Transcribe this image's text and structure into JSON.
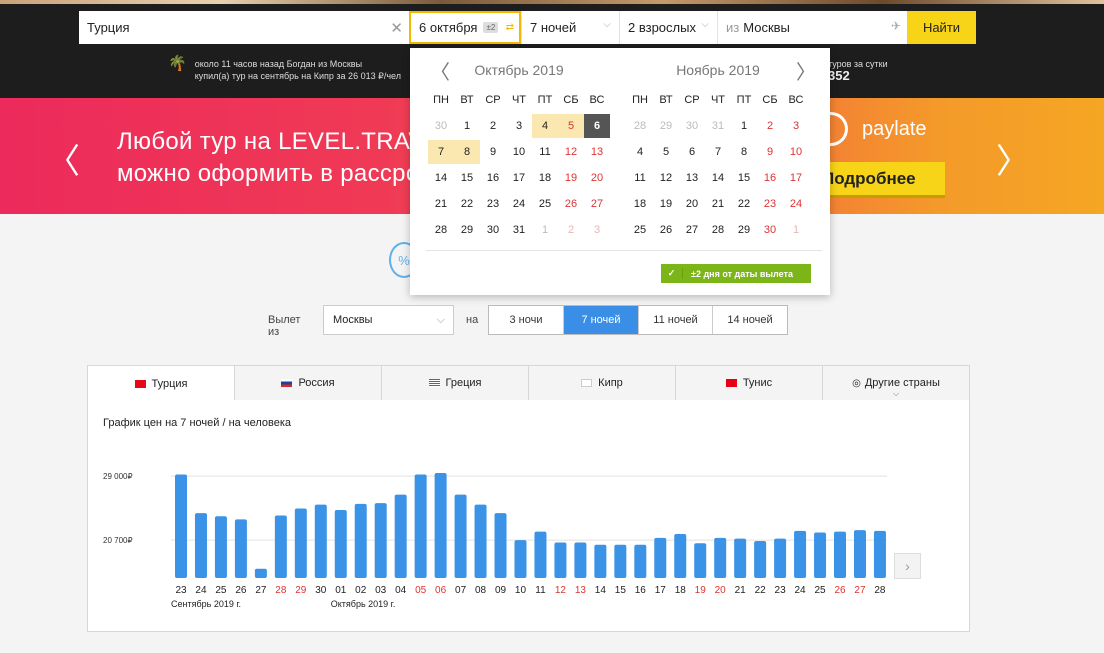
{
  "search": {
    "destination": "Турция",
    "date": "6 октября",
    "date_flex": "±2",
    "nights": "7 ночей",
    "people": "2 взрослых",
    "from_prefix": "из",
    "from_city": "Москвы",
    "find_label": "Найти"
  },
  "ticker": {
    "line1": "около 11 часов назад Богдан из Москвы",
    "line2": "купил(а) тур на сентябрь на Кипр за 26 013 ₽/чел",
    "right_text": "туров за сутки",
    "right_num": "352"
  },
  "banner": {
    "line1": "Любой тур на LEVEL.TRAVEL",
    "line2": "можно оформить в рассрочку",
    "brand": "paylate",
    "more_label": "Подробнее"
  },
  "calendar": {
    "weekdays": [
      "ПН",
      "ВТ",
      "СР",
      "ЧТ",
      "ПТ",
      "СБ",
      "ВС"
    ],
    "months": [
      {
        "title": "Октябрь 2019",
        "weeks": [
          [
            "30",
            "1",
            "2",
            "3",
            "4",
            "5",
            "6"
          ],
          [
            "7",
            "8",
            "9",
            "10",
            "11",
            "12",
            "13"
          ],
          [
            "14",
            "15",
            "16",
            "17",
            "18",
            "19",
            "20"
          ],
          [
            "21",
            "22",
            "23",
            "24",
            "25",
            "26",
            "27"
          ],
          [
            "28",
            "29",
            "30",
            "31",
            "1",
            "2",
            "3"
          ]
        ]
      },
      {
        "title": "Ноябрь 2019",
        "weeks": [
          [
            "28",
            "29",
            "30",
            "31",
            "1",
            "2",
            "3"
          ],
          [
            "4",
            "5",
            "6",
            "7",
            "8",
            "9",
            "10"
          ],
          [
            "11",
            "12",
            "13",
            "14",
            "15",
            "16",
            "17"
          ],
          [
            "18",
            "19",
            "20",
            "21",
            "22",
            "23",
            "24"
          ],
          [
            "25",
            "26",
            "27",
            "28",
            "29",
            "30",
            "1"
          ]
        ]
      }
    ],
    "selected_day": "6",
    "flex_label": "±2 дня от даты вылета"
  },
  "filters": {
    "from_label": "Вылет из",
    "city": "Москвы",
    "to_label": "на",
    "nights_options": [
      "3 ночи",
      "7 ночей",
      "11 ночей",
      "14 ночей"
    ],
    "nights_active": "7 ночей"
  },
  "tabs": [
    {
      "label": "Турция",
      "flag": "tr"
    },
    {
      "label": "Россия",
      "flag": "ru"
    },
    {
      "label": "Греция",
      "flag": "gr"
    },
    {
      "label": "Кипр",
      "flag": "cy"
    },
    {
      "label": "Тунис",
      "flag": "tn"
    },
    {
      "label": "Другие страны",
      "flag": "globe"
    }
  ],
  "chart_title": "График цен на 7 ночей / на человека",
  "chart_data": {
    "type": "bar",
    "categories": [
      "23",
      "24",
      "25",
      "26",
      "27",
      "28",
      "29",
      "30",
      "01",
      "02",
      "03",
      "04",
      "05",
      "06",
      "07",
      "08",
      "09",
      "10",
      "11",
      "12",
      "13",
      "14",
      "15",
      "16",
      "17",
      "18",
      "19",
      "20",
      "21",
      "22",
      "23",
      "24",
      "25",
      "26",
      "27",
      "28"
    ],
    "weekend": [
      false,
      false,
      false,
      false,
      false,
      true,
      true,
      false,
      false,
      false,
      false,
      false,
      true,
      true,
      false,
      false,
      false,
      false,
      false,
      true,
      true,
      false,
      false,
      false,
      false,
      false,
      true,
      true,
      false,
      false,
      false,
      false,
      false,
      true,
      true,
      false
    ],
    "values": [
      29200,
      24200,
      23800,
      23400,
      17000,
      23900,
      24800,
      25300,
      24600,
      25400,
      25500,
      26600,
      29200,
      29400,
      26600,
      25300,
      24200,
      20700,
      21800,
      20400,
      20400,
      20100,
      20100,
      20100,
      21000,
      21500,
      20300,
      21000,
      20900,
      20600,
      20900,
      21900,
      21700,
      21800,
      22000,
      21900
    ],
    "ylabel": "",
    "yticks": [
      "29 000₽",
      "20 700₽"
    ],
    "ytick_values": [
      29000,
      20700
    ],
    "ylim": [
      15800,
      29400
    ],
    "month_labels": [
      "Сентябрь 2019 г.",
      "Октябрь 2019 г."
    ],
    "bar_color": "#3a93e6",
    "weekend_color": "#d33"
  }
}
